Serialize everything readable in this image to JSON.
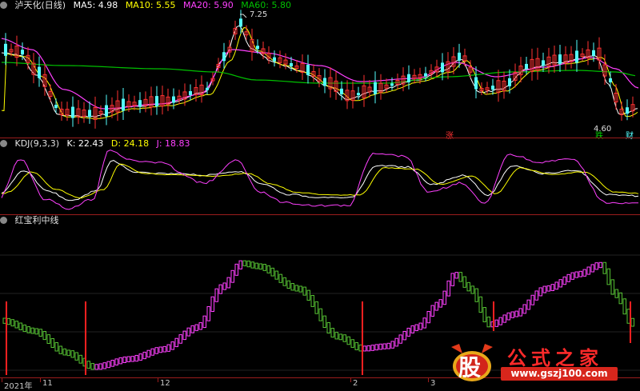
{
  "main": {
    "title": "泸天化(日线)",
    "ma5_label": "MA5: 4.98",
    "ma10_label": "MA10: 5.55",
    "ma20_label": "MA20: 5.90",
    "ma60_label": "MA60: 5.80",
    "high_marker": "7.25",
    "low_marker": "4.60",
    "tag_zhang": "涨",
    "tag_die": "跌",
    "tag_cai": "财"
  },
  "kdj": {
    "title": "KDJ(9,3,3)",
    "k_label": "K: 22.43",
    "d_label": "D: 24.18",
    "j_label": "J: 18.83"
  },
  "indicator": {
    "title": "红宝利中线"
  },
  "xaxis": {
    "labels": [
      "2021年",
      "11",
      "12",
      "2",
      "3"
    ]
  },
  "watermark": {
    "logo_char": "股",
    "brand": "公式之家",
    "url": "www.gszj100.com"
  },
  "colors": {
    "background": "#000000",
    "separator": "#9a1c1c",
    "candle_up": "#ff3232",
    "candle_down": "#54ffff",
    "ma5": "#ffffff",
    "ma10": "#ffff00",
    "ma20": "#ff40ff",
    "ma60": "#00c000",
    "kdj_k": "#ffffff",
    "kdj_d": "#ffff00",
    "kdj_j": "#ff40ff",
    "ind_up": "#ff40ff",
    "ind_down": "#55c032",
    "signal": "#ff2020"
  },
  "chart_data": {
    "type": "line",
    "panels": [
      {
        "name": "price",
        "series_names": [
          "MA5",
          "MA10",
          "MA20",
          "MA60"
        ],
        "max_marker": 7.25,
        "min_marker": 4.6
      },
      {
        "name": "kdj",
        "series_names": [
          "K",
          "D",
          "J"
        ],
        "last_values": {
          "K": 22.43,
          "D": 24.18,
          "J": 18.83
        }
      },
      {
        "name": "indicator",
        "series_names": [
          "红宝利中线"
        ]
      }
    ]
  }
}
